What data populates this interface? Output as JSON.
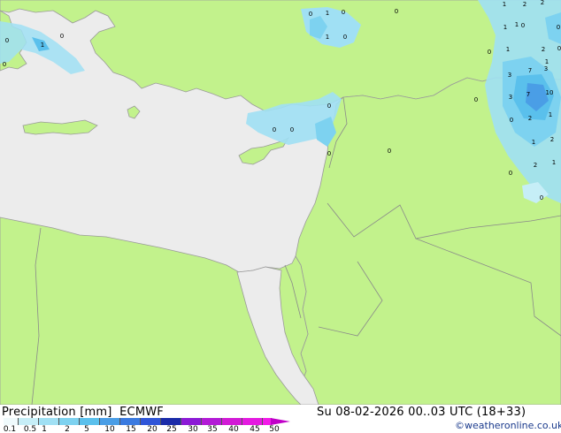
{
  "title": "Precipitation [mm]",
  "model": "ECMWF",
  "run_info": "Su 08-02-2026 00..03 UTC (18+33)",
  "credit": "©weatheronline.co.uk",
  "legend": {
    "ticks": [
      "0.1",
      "0.5",
      "1",
      "2",
      "5",
      "10",
      "15",
      "20",
      "25",
      "30",
      "35",
      "40",
      "45",
      "50"
    ],
    "colors": [
      "#f0fafc",
      "#c6eef7",
      "#a0e0f4",
      "#7dd2f0",
      "#5ac0ec",
      "#4a9ee6",
      "#3a7ae0",
      "#2f55d8",
      "#1a2ba8",
      "#8c1ad6",
      "#b31ad6",
      "#d21ad6",
      "#e41ae0",
      "#f21ae8"
    ]
  },
  "precip_values": [
    {
      "v": "0"
    },
    {
      "v": "1"
    },
    {
      "v": "0"
    },
    {
      "v": "0"
    },
    {
      "v": "1"
    },
    {
      "v": "0"
    },
    {
      "v": "0"
    },
    {
      "v": "1"
    },
    {
      "v": "0"
    },
    {
      "v": "1"
    },
    {
      "v": "2"
    },
    {
      "v": "2"
    },
    {
      "v": "1"
    },
    {
      "v": "0"
    },
    {
      "v": "0"
    },
    {
      "v": "0"
    },
    {
      "v": "1"
    },
    {
      "v": "2"
    },
    {
      "v": "0"
    },
    {
      "v": "1"
    },
    {
      "v": "1"
    },
    {
      "v": "0"
    },
    {
      "v": "0"
    },
    {
      "v": "0"
    },
    {
      "v": "0"
    },
    {
      "v": "0"
    },
    {
      "v": "3"
    },
    {
      "v": "7"
    },
    {
      "v": "3"
    },
    {
      "v": "3"
    },
    {
      "v": "7"
    },
    {
      "v": "10"
    },
    {
      "v": "0"
    },
    {
      "v": "0"
    },
    {
      "v": "2"
    },
    {
      "v": "1"
    },
    {
      "v": "1"
    },
    {
      "v": "2"
    },
    {
      "v": "0"
    },
    {
      "v": "2"
    },
    {
      "v": "1"
    },
    {
      "v": "0"
    },
    {
      "v": "0"
    }
  ]
}
